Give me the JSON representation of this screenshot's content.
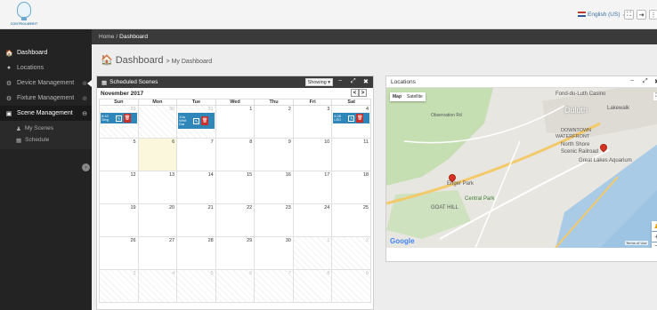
{
  "header": {
    "logo_text": "CONTROLMERIT",
    "language": "English (US)",
    "language_caret": "⌄",
    "expand_icon": "⛶",
    "logout_icon": "⇥",
    "more_icon": "⋮"
  },
  "sidebar": {
    "items": [
      {
        "label": "Dashboard",
        "icon": "home-icon",
        "glyph": "🏠",
        "plus": ""
      },
      {
        "label": "Locations",
        "icon": "globe-icon",
        "glyph": "●",
        "plus": ""
      },
      {
        "label": "Device Management",
        "icon": "cogs-icon",
        "glyph": "⚙",
        "plus": "⊕"
      },
      {
        "label": "Fixture Management",
        "icon": "cogs-icon",
        "glyph": "⚙",
        "plus": "⊕"
      },
      {
        "label": "Scene Management",
        "icon": "picture-icon",
        "glyph": "▣",
        "plus": "⊖"
      }
    ],
    "sub_items": [
      {
        "label": "My Scenes",
        "icon": "user-icon",
        "glyph": "♟"
      },
      {
        "label": "Schedule",
        "icon": "calendar-icon",
        "glyph": "▦"
      }
    ],
    "collapse_glyph": "‹"
  },
  "breadcrumb": {
    "home": "Home",
    "sep": "/",
    "current": "Dashboard"
  },
  "page": {
    "title": "Dashboard",
    "subtitle": "> My Dashboard",
    "title_glyph": "🏠"
  },
  "calendar": {
    "panel_title": "Scheduled Scenes",
    "panel_glyph": "▦",
    "showing_label": "Showing ▾",
    "minimize": "−",
    "expand": "⤢",
    "close": "✖",
    "month": "November 2017",
    "prev": "<",
    "next": ">",
    "days": [
      "Sun",
      "Mon",
      "Tue",
      "Wed",
      "Thu",
      "Fri",
      "Sat"
    ],
    "weeks": [
      [
        "29",
        "30",
        "31",
        "1",
        "2",
        "3",
        "4"
      ],
      [
        "5",
        "6",
        "7",
        "8",
        "9",
        "10",
        "11"
      ],
      [
        "12",
        "13",
        "14",
        "15",
        "16",
        "17",
        "18"
      ],
      [
        "19",
        "20",
        "21",
        "22",
        "23",
        "24",
        "25"
      ],
      [
        "26",
        "27",
        "28",
        "29",
        "30",
        "1",
        "2"
      ],
      [
        "3",
        "4",
        "5",
        "6",
        "7",
        "8",
        "9"
      ]
    ],
    "events": [
      {
        "text": "8:43 Sing",
        "edit": "✎",
        "delete": "🗑"
      },
      {
        "text": "10a Whit Dar",
        "edit": "✎",
        "delete": "🗑"
      },
      {
        "text": "6:26 LED",
        "edit": "✎",
        "delete": "🗑"
      }
    ]
  },
  "locations": {
    "panel_title": "Locations",
    "minimize": "−",
    "expand": "⤢",
    "close": "✖",
    "map_button": "Map",
    "satellite_button": "Satellite",
    "labels": [
      "Fond-du-Luth Casino",
      "Duluth",
      "Lakewalk",
      "DOWNTOWN",
      "WATERFRONT",
      "North Shore",
      "Scenic Railroad",
      "Great Lakes Aquarium",
      "Enger Park",
      "Central Park",
      "GOAT HILL",
      "Observation Rd"
    ],
    "google": "Google",
    "terms": "Terms of Use",
    "zoom_in": "+",
    "zoom_out": "−",
    "pegman": "♟"
  }
}
